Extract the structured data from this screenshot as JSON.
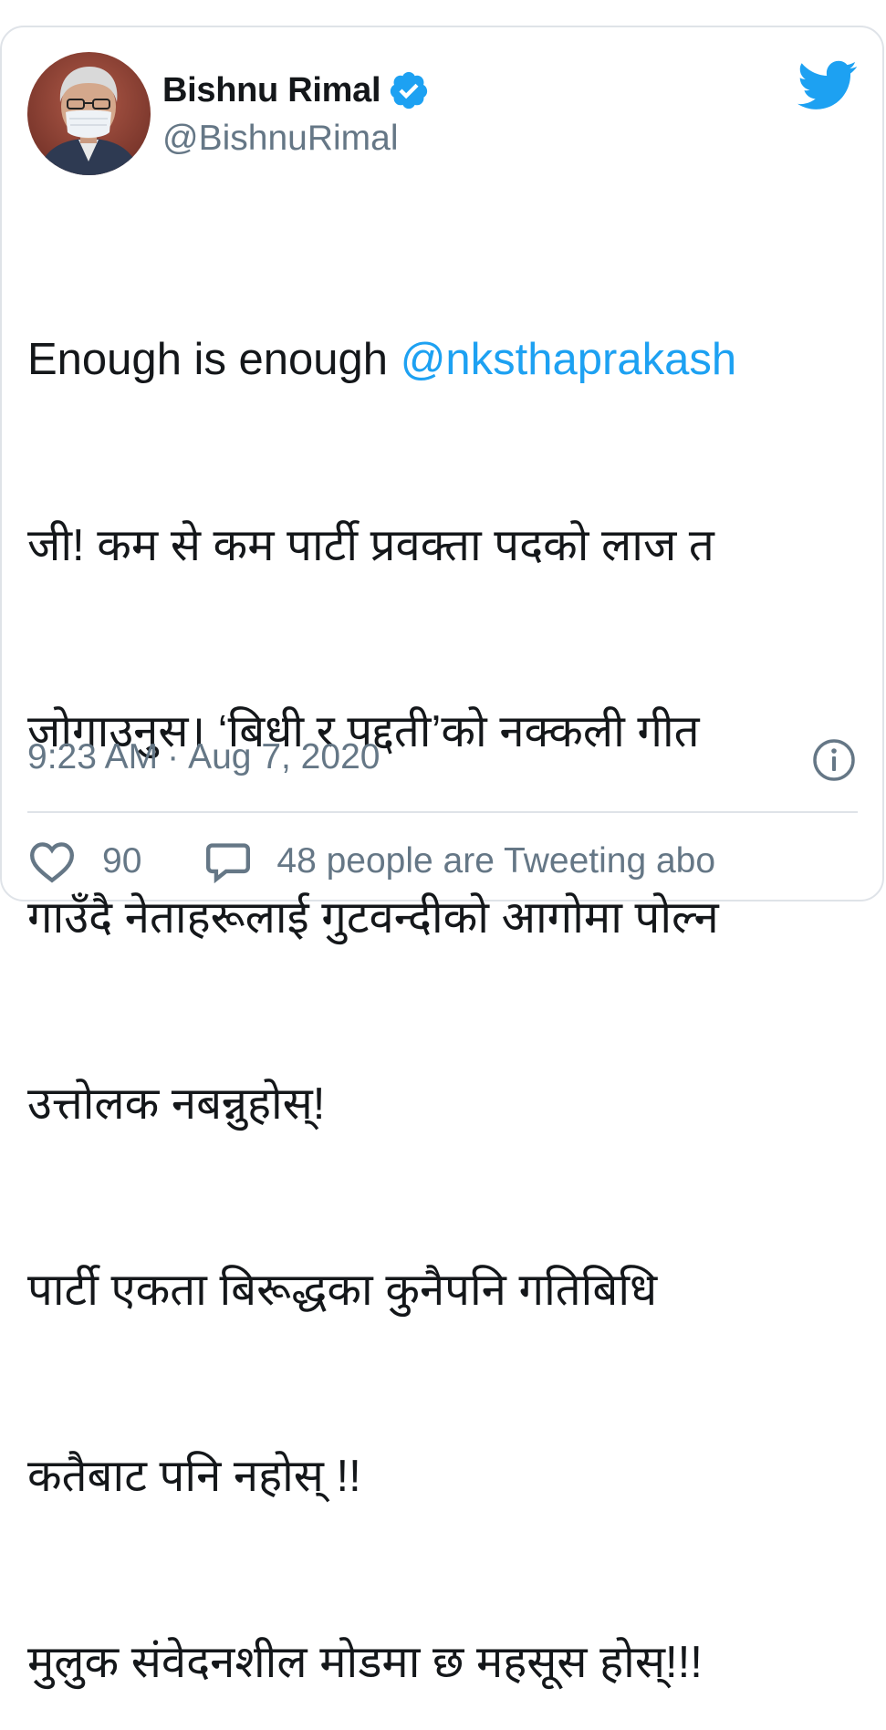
{
  "user": {
    "display_name": "Bishnu Rimal",
    "handle": "@BishnuRimal",
    "verified": true
  },
  "icons": {
    "verified": "verified-badge-icon",
    "brand": "twitter-bird-icon",
    "info": "info-icon",
    "like": "heart-icon",
    "conversation": "speech-bubble-icon"
  },
  "tweet": {
    "intro": "Enough is enough ",
    "mention": "@nksthaprakash",
    "lines": [
      "जी! कम से कम पार्टी प्रवक्ता पदको लाज त",
      "जोगाउनुस। ‘बिधी र पद्दती’को नक्कली गीत",
      "गाउँदै नेताहरूलाई गुटवन्दीको आगोमा पोल्न",
      "उत्तोलक नबन्नुहोस्!",
      "पार्टी एकता बिरूद्धका कुनैपनि गतिबिधि",
      "कतैबाट पनि नहोस् !!",
      "मुलुक संवेदनशील मोडमा छ महसूस होस्!!!"
    ]
  },
  "meta": {
    "time": "9:23 AM",
    "separator": "·",
    "date": "Aug 7, 2020"
  },
  "actions": {
    "like_count": "90",
    "tweeting_text": "48 people are Tweeting abo"
  },
  "colors": {
    "accent": "#1da1f2",
    "text": "#14171a",
    "secondary": "#657786",
    "border": "#dfe3e8"
  }
}
